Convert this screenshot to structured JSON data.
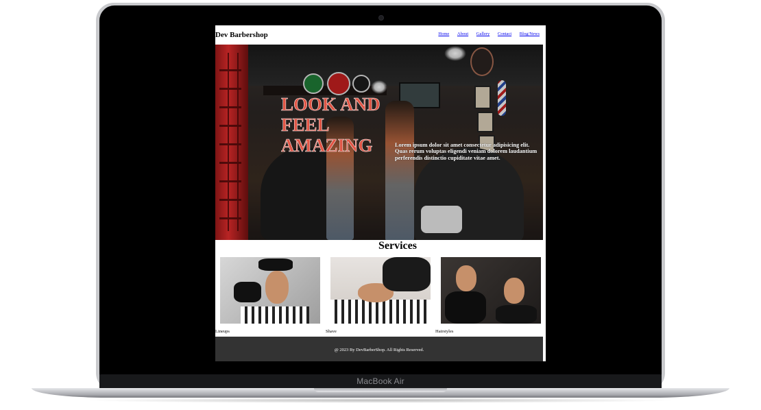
{
  "device": {
    "brand": "MacBook Air"
  },
  "site": {
    "title": "Dev Barbershop",
    "nav": [
      "Home",
      "About",
      "Gallery",
      "Contact",
      "Blog/News"
    ]
  },
  "hero": {
    "title": "LOOK AND FEEL AMAZING",
    "text": "Lorem ipsum dolor sit amet consectetur adipisicing elit. Quas rerum voluptas eligendi veniam dolorem laudantium perferendis distinctio cupiditate vitae amet."
  },
  "services": {
    "title": "Services",
    "items": [
      "Lineups",
      "Shave",
      "Hairstyles"
    ]
  },
  "footer": {
    "text": "@ 2023 By DevBarberShop. All Rights Reserved."
  },
  "colors": {
    "hero_title": "#e05545",
    "footer_bg": "#333333",
    "link": "#0000ee"
  }
}
